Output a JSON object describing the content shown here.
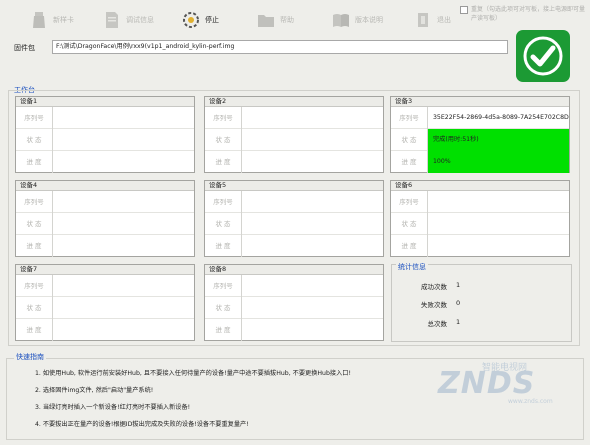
{
  "toolbar": {
    "buttons": [
      {
        "label": "新样卡",
        "icon": "bottle-icon",
        "active": false
      },
      {
        "label": "调试信息",
        "icon": "document-icon",
        "active": false
      },
      {
        "label": "停止",
        "icon": "stop-icon",
        "active": true
      },
      {
        "label": "帮助",
        "icon": "folder-icon",
        "active": false
      },
      {
        "label": "版本说明",
        "icon": "book-icon",
        "active": false
      },
      {
        "label": "退出",
        "icon": "exit-icon",
        "active": false
      }
    ],
    "option_text": "重复（勾选此项可对写板，接上电源即可量产读写板）"
  },
  "firmware": {
    "label": "固件包",
    "path": "F:\\测试\\DragonFace\\用例\\rxx9(v1p1_android_kylin-perf.img"
  },
  "status_icon": "checkmark-icon",
  "workbench": {
    "title": "工作台",
    "field_labels": {
      "serial": "序列号",
      "state": "状    态",
      "progress": "进    度"
    },
    "devices": [
      {
        "name": "设备1",
        "serial": "",
        "state": "",
        "progress": "",
        "done": false
      },
      {
        "name": "设备2",
        "serial": "",
        "state": "",
        "progress": "",
        "done": false
      },
      {
        "name": "设备3",
        "serial": "35E22F54-2869-4d5a-8089-7A254E702C8D",
        "state": "完成(用时:51秒)",
        "progress": "100%",
        "done": true
      },
      {
        "name": "设备4",
        "serial": "",
        "state": "",
        "progress": "",
        "done": false
      },
      {
        "name": "设备5",
        "serial": "",
        "state": "",
        "progress": "",
        "done": false
      },
      {
        "name": "设备6",
        "serial": "",
        "state": "",
        "progress": "",
        "done": false
      },
      {
        "name": "设备7",
        "serial": "",
        "state": "",
        "progress": "",
        "done": false
      },
      {
        "name": "设备8",
        "serial": "",
        "state": "",
        "progress": "",
        "done": false
      }
    ]
  },
  "stats": {
    "title": "统计信息",
    "rows": [
      {
        "label": "成功次数",
        "value": "1"
      },
      {
        "label": "失败次数",
        "value": "0"
      },
      {
        "label": "总次数",
        "value": "1"
      }
    ]
  },
  "guide": {
    "title": "快速指南",
    "items": [
      "1. 如使用Hub, 软件运行前安装好Hub, 且不要接入任何待量产的设备!量产中途不要插拔Hub, 不要更换Hub接入口!",
      "2. 选择固件img文件, 然后\"启动\"量产系统!",
      "3. 当绿灯亮时插入一个新设备!红灯亮时不要插入新设备!",
      "4. 不要拔出正在量产的设备!根据ID拔出完成及失败的设备!设备不要重复量产!"
    ]
  },
  "watermark": {
    "brand": "ZNDS",
    "tagline": "智能电视网",
    "url": "www.znds.com"
  },
  "colors": {
    "accent_blue": "#1a4fbf",
    "success_green": "#00e000",
    "ok_tile": "#1c9a34"
  }
}
